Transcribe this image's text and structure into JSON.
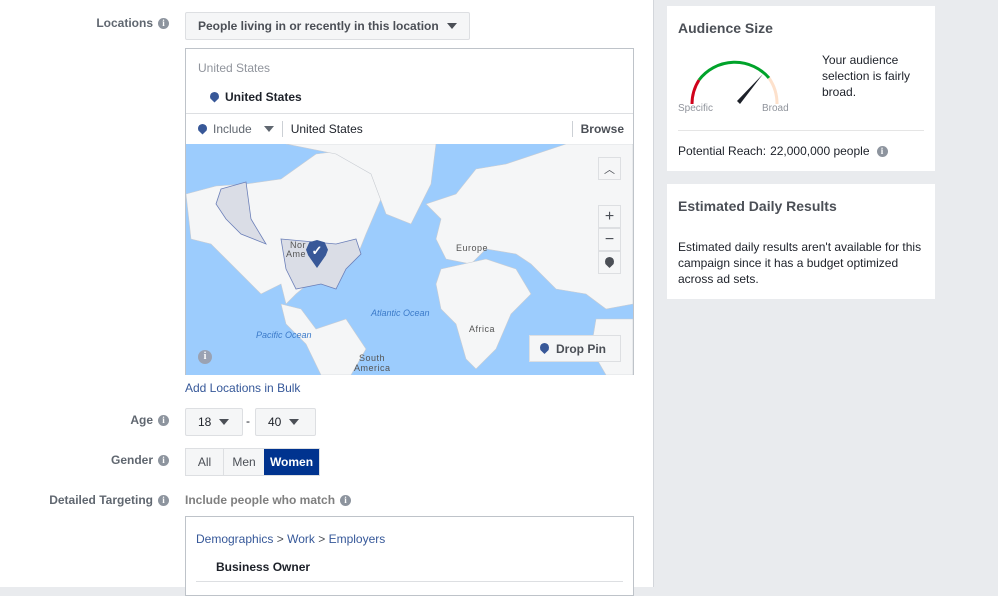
{
  "locations": {
    "label": "Locations",
    "mode": "People living in or recently in this location",
    "header": "United States",
    "selected": "United States",
    "include": "Include",
    "input_value": "United States",
    "browse": "Browse",
    "add_bulk": "Add Locations in Bulk",
    "map": {
      "labels": {
        "north_america_1": "Nor",
        "north_america_2": "Ame",
        "europe": "Europe",
        "africa": "Africa",
        "south_america_1": "South",
        "south_america_2": "America",
        "atlantic": "Atlantic Ocean",
        "pacific": "Pacific Ocean"
      },
      "drop_pin": "Drop Pin",
      "collapse_icon": "chevron-up-icon",
      "zoom_in": "+",
      "zoom_out": "−",
      "water_color": "#9cccfd",
      "land_color": "#f5f6f7",
      "selected_color": "#dadde6"
    }
  },
  "age": {
    "label": "Age",
    "min": "18",
    "max": "40",
    "separator": "-"
  },
  "gender": {
    "label": "Gender",
    "options": [
      "All",
      "Men",
      "Women"
    ],
    "selected": "Women",
    "accent": "#00338f"
  },
  "detailed": {
    "label": "Detailed Targeting",
    "hint": "Include people who match",
    "breadcrumb": [
      "Demographics",
      "Work",
      "Employers"
    ],
    "sep": ">",
    "item": "Business Owner"
  },
  "audience": {
    "title": "Audience Size",
    "description": "Your audience selection is fairly broad.",
    "specific": "Specific",
    "broad": "Broad",
    "reach_label": "Potential Reach:",
    "reach_value": "22,000,000 people",
    "gauge_level": 0.75
  },
  "daily": {
    "title": "Estimated Daily Results",
    "text": "Estimated daily results aren't available for this campaign since it has a budget optimized across ad sets."
  }
}
